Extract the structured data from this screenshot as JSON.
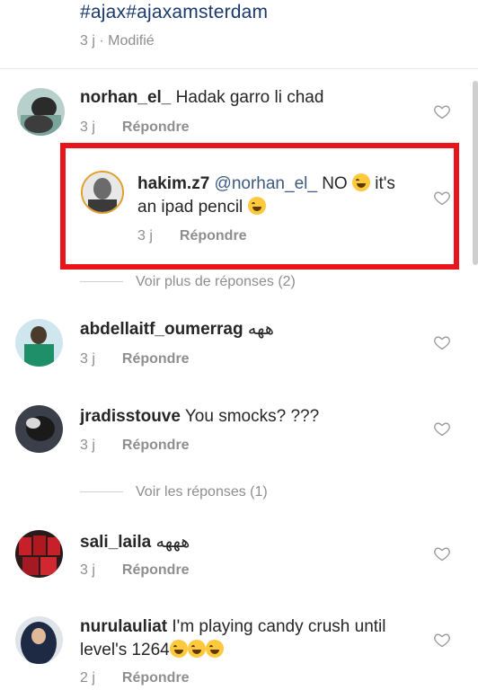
{
  "post": {
    "hashtags": "#ajax#ajaxamsterdam",
    "time": "3 j · Modifié"
  },
  "reply_label": "Répondre",
  "comments": [
    {
      "user": "norhan_el_",
      "text": "Hadak garro li chad",
      "time": "3 j"
    },
    {
      "user": "hakim.z7",
      "mention": "@norhan_el_",
      "text_a": "NO",
      "text_b": "it's",
      "text_c": "an ipad pencil",
      "time": "3 j"
    },
    {
      "user": "abdellaitf_oumerrag",
      "text": "ههه",
      "time": "3 j"
    },
    {
      "user": "jradisstouve",
      "text": "You smocks? ???",
      "time": "3 j"
    },
    {
      "user": "sali_laila",
      "text": "هههه",
      "time": "3 j"
    },
    {
      "user": "nurulauliat",
      "text": "I'm playing candy crush until",
      "text2": "level's 1264",
      "time": "2 j"
    }
  ],
  "view_more": "Voir plus de réponses (2)",
  "view_replies": "Voir les réponses (1)",
  "icons": {
    "like": "heart-outline-icon"
  },
  "colors": {
    "highlight": "#e8161c",
    "mention": "#3d5a80"
  }
}
